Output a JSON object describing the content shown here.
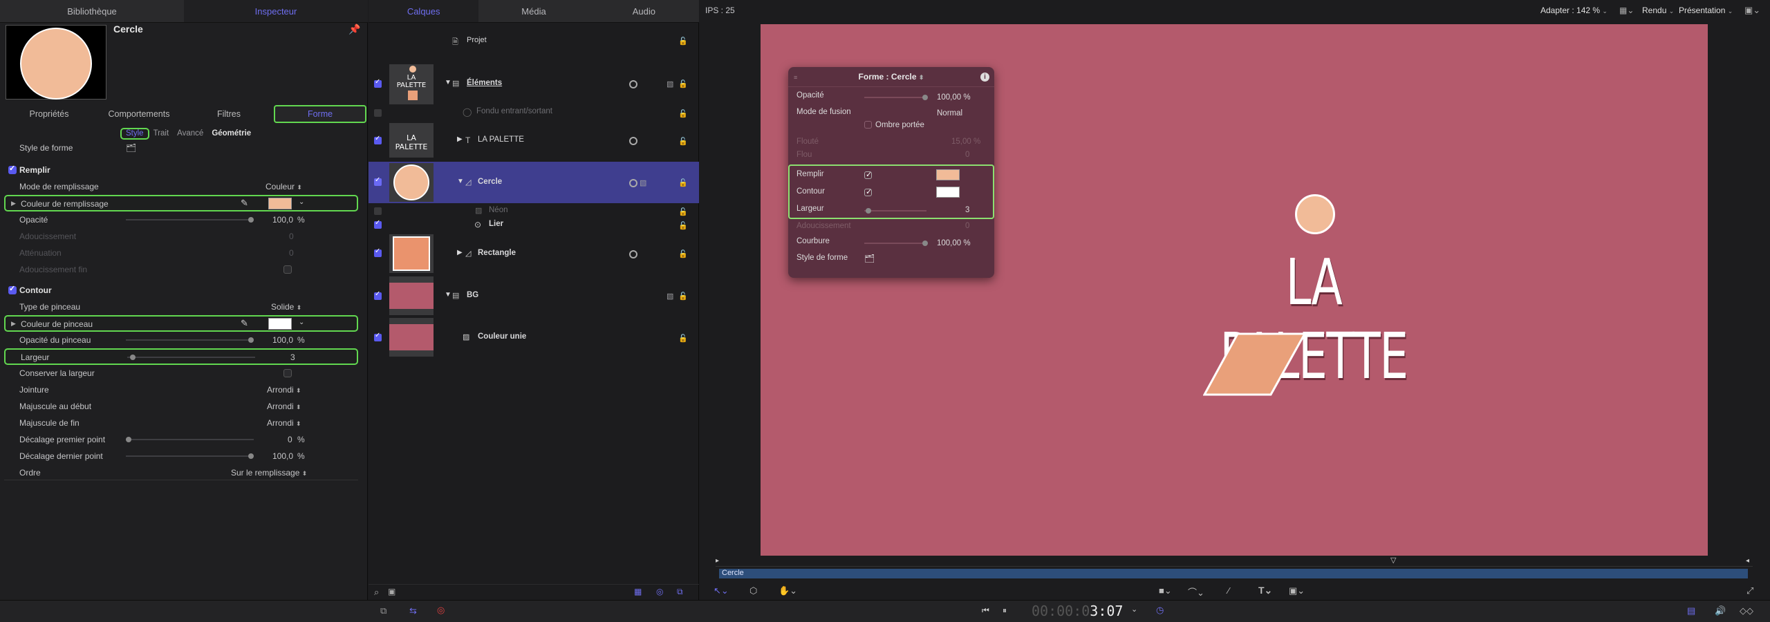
{
  "left_tabs": [
    "Bibliothèque",
    "Inspecteur"
  ],
  "layers_tabs": [
    "Calques",
    "Média",
    "Audio"
  ],
  "viewer_toolbar": {
    "ips": "IPS : 25",
    "adapter": "Adapter : 142 %",
    "render": "Rendu",
    "presentation": "Présentation"
  },
  "inspector": {
    "title": "Cercle",
    "subtabs": [
      "Propriétés",
      "Comportements",
      "Filtres",
      "Forme"
    ],
    "minitabs": [
      "Style",
      "Trait",
      "Avancé",
      "Géométrie"
    ],
    "style_de_forme": "Style de forme",
    "remplir": {
      "section": "Remplir",
      "mode_label": "Mode de remplissage",
      "mode_value": "Couleur",
      "color_label": "Couleur de remplissage",
      "opacity_label": "Opacité",
      "opacity_value": "100,0",
      "opacity_unit": "%",
      "dim1_label": "Adoucissement",
      "dim1_value": "0",
      "dim2_label": "Atténuation",
      "dim2_value": "0",
      "dim3_label": "Adoucissement fin"
    },
    "contour": {
      "section": "Contour",
      "brush_type_label": "Type de pinceau",
      "brush_type_value": "Solide",
      "brush_color_label": "Couleur de pinceau",
      "brush_opacity_label": "Opacité du pinceau",
      "brush_opacity_value": "100,0",
      "brush_opacity_unit": "%",
      "width_label": "Largeur",
      "width_value": "3",
      "keep_width_label": "Conserver la largeur",
      "joint_label": "Jointure",
      "joint_value": "Arrondi",
      "start_cap_label": "Majuscule au début",
      "start_cap_value": "Arrondi",
      "end_cap_label": "Majuscule de fin",
      "end_cap_value": "Arrondi",
      "first_offset_label": "Décalage premier point",
      "first_offset_value": "0",
      "first_offset_unit": "%",
      "last_offset_label": "Décalage dernier point",
      "last_offset_value": "100,0",
      "last_offset_unit": "%",
      "order_label": "Ordre",
      "order_value": "Sur le remplissage"
    }
  },
  "layers": {
    "projet": "Projet",
    "elements": "Éléments",
    "fondu": "Fondu entrant/sortant",
    "la_palette": "LA PALETTE",
    "cercle": "Cercle",
    "neon": "Néon",
    "lier": "Lier",
    "rectangle": "Rectangle",
    "bg": "BG",
    "couleur_unie": "Couleur unie",
    "thumb_text": "LA PALETTE"
  },
  "hud": {
    "title": "Forme : Cercle",
    "opacity_label": "Opacité",
    "opacity_value": "100,00 %",
    "fusion_label": "Mode de fusion",
    "fusion_value": "Normal",
    "shadow_label": "Ombre portée",
    "dim1_label": "Flouté",
    "dim1_value": "15,00 %",
    "dim2_label": "Flou",
    "dim2_value": "0",
    "remplir_label": "Remplir",
    "contour_label": "Contour",
    "largeur_label": "Largeur",
    "largeur_value": "3",
    "dim3_label": "Adoucissement",
    "dim3_value": "0",
    "courbure_label": "Courbure",
    "courbure_value": "100,00 %",
    "style_label": "Style de forme"
  },
  "canvas": {
    "title_text": "LA PALETTE",
    "timeline_label": "Cercle"
  },
  "timecode": {
    "dim": "00:00:0",
    "bright": "3:07"
  },
  "colors": {
    "fill": "#f1bb98",
    "stroke": "#ffffff",
    "accent": "#6f6ef0",
    "highlight": "#62d850",
    "background": "#b45a6c",
    "parallelogram": "#e9a07a"
  }
}
